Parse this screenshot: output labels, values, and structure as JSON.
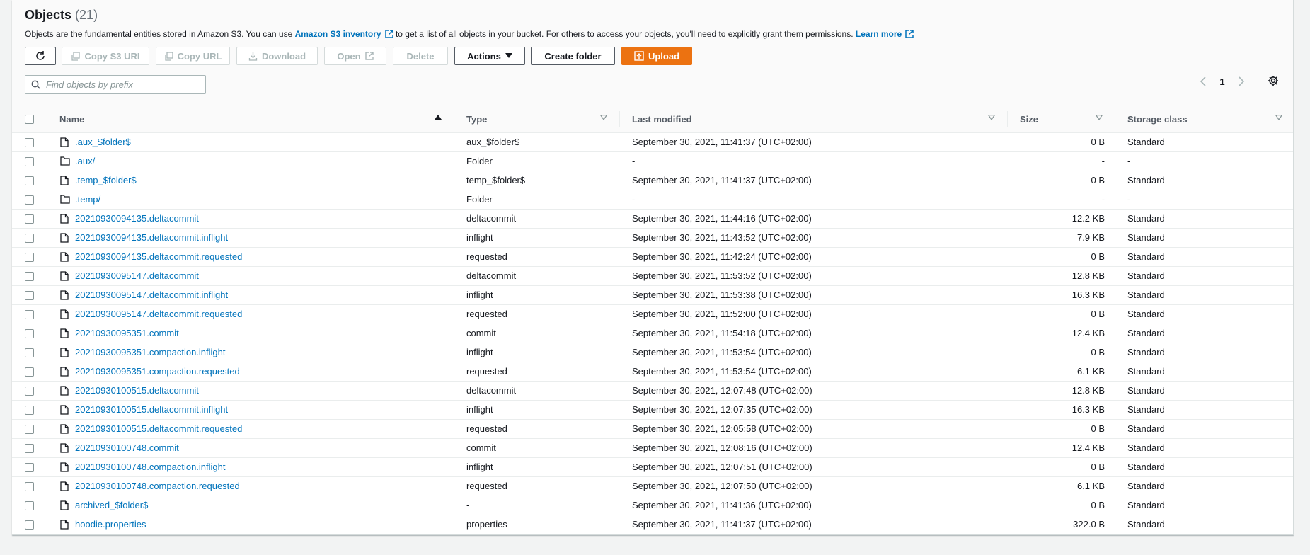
{
  "header": {
    "title": "Objects",
    "count": "(21)",
    "desc_before": "Objects are the fundamental entities stored in Amazon S3. You can use ",
    "desc_link1": "Amazon S3 inventory",
    "desc_middle": " to get a list of all objects in your bucket. For others to access your objects, you'll need to explicitly grant them permissions. ",
    "desc_link2": "Learn more"
  },
  "toolbar": {
    "copy_s3_uri": "Copy S3 URI",
    "copy_url": "Copy URL",
    "download": "Download",
    "open": "Open",
    "delete": "Delete",
    "actions": "Actions",
    "create_folder": "Create folder",
    "upload": "Upload"
  },
  "search": {
    "placeholder": "Find objects by prefix"
  },
  "pagination": {
    "page": "1"
  },
  "columns": {
    "name": "Name",
    "type": "Type",
    "last_modified": "Last modified",
    "size": "Size",
    "storage_class": "Storage class"
  },
  "rows": [
    {
      "icon": "file-icon",
      "name": ".aux_$folder$",
      "type": "aux_$folder$",
      "modified": "September 30, 2021, 11:41:37 (UTC+02:00)",
      "size": "0 B",
      "storage": "Standard"
    },
    {
      "icon": "folder-icon",
      "name": ".aux/",
      "type": "Folder",
      "modified": "-",
      "size": "-",
      "storage": "-"
    },
    {
      "icon": "file-icon",
      "name": ".temp_$folder$",
      "type": "temp_$folder$",
      "modified": "September 30, 2021, 11:41:37 (UTC+02:00)",
      "size": "0 B",
      "storage": "Standard"
    },
    {
      "icon": "folder-icon",
      "name": ".temp/",
      "type": "Folder",
      "modified": "-",
      "size": "-",
      "storage": "-"
    },
    {
      "icon": "file-icon",
      "name": "20210930094135.deltacommit",
      "type": "deltacommit",
      "modified": "September 30, 2021, 11:44:16 (UTC+02:00)",
      "size": "12.2 KB",
      "storage": "Standard"
    },
    {
      "icon": "file-icon",
      "name": "20210930094135.deltacommit.inflight",
      "type": "inflight",
      "modified": "September 30, 2021, 11:43:52 (UTC+02:00)",
      "size": "7.9 KB",
      "storage": "Standard"
    },
    {
      "icon": "file-icon",
      "name": "20210930094135.deltacommit.requested",
      "type": "requested",
      "modified": "September 30, 2021, 11:42:24 (UTC+02:00)",
      "size": "0 B",
      "storage": "Standard"
    },
    {
      "icon": "file-icon",
      "name": "20210930095147.deltacommit",
      "type": "deltacommit",
      "modified": "September 30, 2021, 11:53:52 (UTC+02:00)",
      "size": "12.8 KB",
      "storage": "Standard"
    },
    {
      "icon": "file-icon",
      "name": "20210930095147.deltacommit.inflight",
      "type": "inflight",
      "modified": "September 30, 2021, 11:53:38 (UTC+02:00)",
      "size": "16.3 KB",
      "storage": "Standard"
    },
    {
      "icon": "file-icon",
      "name": "20210930095147.deltacommit.requested",
      "type": "requested",
      "modified": "September 30, 2021, 11:52:00 (UTC+02:00)",
      "size": "0 B",
      "storage": "Standard"
    },
    {
      "icon": "file-icon",
      "name": "20210930095351.commit",
      "type": "commit",
      "modified": "September 30, 2021, 11:54:18 (UTC+02:00)",
      "size": "12.4 KB",
      "storage": "Standard"
    },
    {
      "icon": "file-icon",
      "name": "20210930095351.compaction.inflight",
      "type": "inflight",
      "modified": "September 30, 2021, 11:53:54 (UTC+02:00)",
      "size": "0 B",
      "storage": "Standard"
    },
    {
      "icon": "file-icon",
      "name": "20210930095351.compaction.requested",
      "type": "requested",
      "modified": "September 30, 2021, 11:53:54 (UTC+02:00)",
      "size": "6.1 KB",
      "storage": "Standard"
    },
    {
      "icon": "file-icon",
      "name": "20210930100515.deltacommit",
      "type": "deltacommit",
      "modified": "September 30, 2021, 12:07:48 (UTC+02:00)",
      "size": "12.8 KB",
      "storage": "Standard"
    },
    {
      "icon": "file-icon",
      "name": "20210930100515.deltacommit.inflight",
      "type": "inflight",
      "modified": "September 30, 2021, 12:07:35 (UTC+02:00)",
      "size": "16.3 KB",
      "storage": "Standard"
    },
    {
      "icon": "file-icon",
      "name": "20210930100515.deltacommit.requested",
      "type": "requested",
      "modified": "September 30, 2021, 12:05:58 (UTC+02:00)",
      "size": "0 B",
      "storage": "Standard"
    },
    {
      "icon": "file-icon",
      "name": "20210930100748.commit",
      "type": "commit",
      "modified": "September 30, 2021, 12:08:16 (UTC+02:00)",
      "size": "12.4 KB",
      "storage": "Standard"
    },
    {
      "icon": "file-icon",
      "name": "20210930100748.compaction.inflight",
      "type": "inflight",
      "modified": "September 30, 2021, 12:07:51 (UTC+02:00)",
      "size": "0 B",
      "storage": "Standard"
    },
    {
      "icon": "file-icon",
      "name": "20210930100748.compaction.requested",
      "type": "requested",
      "modified": "September 30, 2021, 12:07:50 (UTC+02:00)",
      "size": "6.1 KB",
      "storage": "Standard"
    },
    {
      "icon": "file-icon",
      "name": "archived_$folder$",
      "type": "-",
      "modified": "September 30, 2021, 11:41:36 (UTC+02:00)",
      "size": "0 B",
      "storage": "Standard"
    },
    {
      "icon": "file-icon",
      "name": "hoodie.properties",
      "type": "properties",
      "modified": "September 30, 2021, 11:41:37 (UTC+02:00)",
      "size": "322.0 B",
      "storage": "Standard"
    }
  ],
  "colors": {
    "link": "#0073bb",
    "primary": "#ec7211",
    "disabled": "#aab7b8",
    "text": "#16191f"
  }
}
